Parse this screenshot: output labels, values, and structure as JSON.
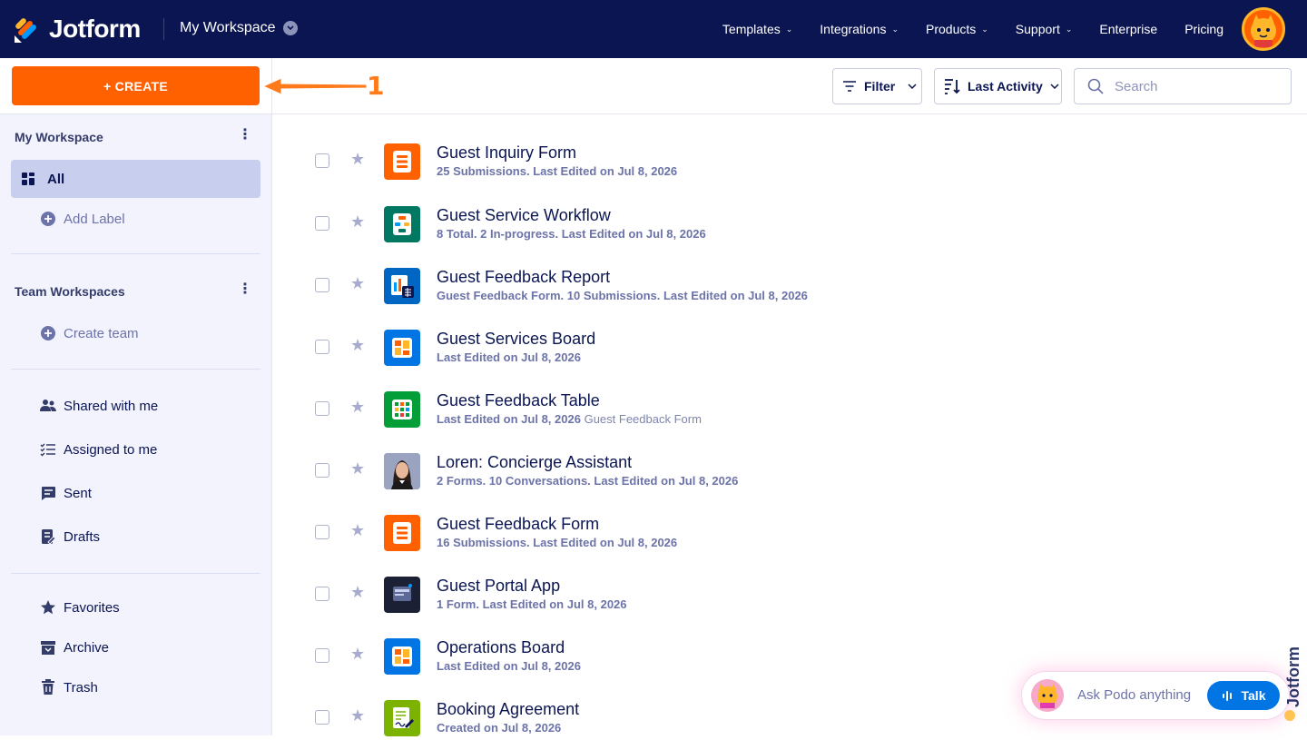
{
  "header": {
    "logo_text": "Jotform",
    "workspace_title": "My Workspace",
    "nav": [
      {
        "label": "Templates",
        "has_menu": true
      },
      {
        "label": "Integrations",
        "has_menu": true
      },
      {
        "label": "Products",
        "has_menu": true
      },
      {
        "label": "Support",
        "has_menu": true
      },
      {
        "label": "Enterprise",
        "has_menu": false
      },
      {
        "label": "Pricing",
        "has_menu": false
      }
    ]
  },
  "toolbar": {
    "create_label": "+ CREATE",
    "annotation_number": "1",
    "filter_label": "Filter",
    "sort_label": "Last Activity",
    "search_placeholder": "Search",
    "search_value": ""
  },
  "sidebar": {
    "my_workspace_title": "My Workspace",
    "all_label": "All",
    "add_label": "Add Label",
    "team_workspaces_title": "Team Workspaces",
    "create_team_label": "Create team",
    "shared_label": "Shared with me",
    "assigned_label": "Assigned to me",
    "sent_label": "Sent",
    "drafts_label": "Drafts",
    "favorites_label": "Favorites",
    "archive_label": "Archive",
    "trash_label": "Trash"
  },
  "items": [
    {
      "title": "Guest Inquiry Form",
      "subtitle": "25 Submissions. Last Edited on Jul 8, 2026",
      "extra": "",
      "icon": "form-icon",
      "color": "#ff6100"
    },
    {
      "title": "Guest Service Workflow",
      "subtitle": "8 Total. 2 In-progress. Last Edited on Jul 8, 2026",
      "extra": "",
      "icon": "workflow-icon",
      "color": "#007862"
    },
    {
      "title": "Guest Feedback Report",
      "subtitle": "Guest Feedback Form. 10 Submissions. Last Edited on Jul 8, 2026",
      "extra": "",
      "icon": "report-icon",
      "color": "#0066c3"
    },
    {
      "title": "Guest Services Board",
      "subtitle": "Last Edited on Jul 8, 2026",
      "extra": "",
      "icon": "board-icon",
      "color": "#0075e3"
    },
    {
      "title": "Guest Feedback Table",
      "subtitle": "Last Edited on Jul 8, 2026",
      "extra": "Guest Feedback Form",
      "icon": "table-icon",
      "color": "#049e38"
    },
    {
      "title": "Loren: Concierge Assistant",
      "subtitle": "2 Forms. 10 Conversations. Last Edited on Jul 8, 2026",
      "extra": "",
      "icon": "agent-avatar-icon",
      "color": "#5e6a96"
    },
    {
      "title": "Guest Feedback Form",
      "subtitle": "16 Submissions. Last Edited on Jul 8, 2026",
      "extra": "",
      "icon": "form-icon",
      "color": "#ff6100"
    },
    {
      "title": "Guest Portal App",
      "subtitle": "1 Form. Last Edited on Jul 8, 2026",
      "extra": "",
      "icon": "app-icon",
      "color": "#1c2035"
    },
    {
      "title": "Operations Board",
      "subtitle": "Last Edited on Jul 8, 2026",
      "extra": "",
      "icon": "board-icon",
      "color": "#0075e3"
    },
    {
      "title": "Booking Agreement",
      "subtitle": "Created on Jul 8, 2026",
      "extra": "",
      "icon": "sign-document-icon",
      "color": "#7bb300"
    }
  ],
  "assistant": {
    "prompt": "Ask Podo anything",
    "talk_label": "Talk"
  }
}
